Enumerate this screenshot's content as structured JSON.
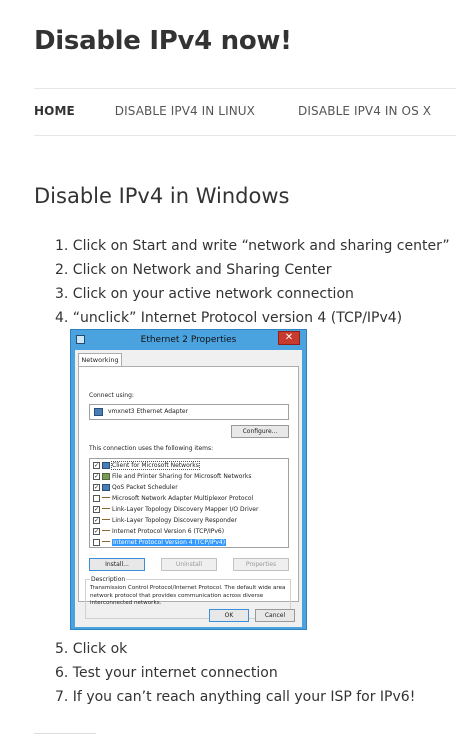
{
  "site": {
    "title": "Disable IPv4 now!"
  },
  "nav": {
    "items": [
      {
        "label": "HOME",
        "active": true
      },
      {
        "label": "DISABLE IPV4 IN LINUX",
        "active": false
      },
      {
        "label": "DISABLE IPV4 IN OS X",
        "active": false
      }
    ]
  },
  "article": {
    "title": "Disable IPv4 in Windows",
    "steps_before": [
      "1. Click on Start and write “network and sharing center”",
      "2. Click on Network and Sharing Center",
      "3. Click on your active network connection",
      "4. “unclick” Internet Protocol version 4 (TCP/IPv4)"
    ],
    "steps_after": [
      "5. Click ok",
      "6. Test your internet connection",
      "7. If you can’t reach anything call your ISP for IPv6!"
    ]
  },
  "dialog": {
    "title": "Ethernet 2 Properties",
    "close_glyph": "✕",
    "tab": "Networking",
    "connect_using_label": "Connect using:",
    "adapter": "vmxnet3 Ethernet Adapter",
    "configure_label": "Configure...",
    "items_label": "This connection uses the following items:",
    "items": [
      {
        "label": "Client for Microsoft Networks",
        "checked": true,
        "icon": "net"
      },
      {
        "label": "File and Printer Sharing for Microsoft Networks",
        "checked": true,
        "icon": "prt"
      },
      {
        "label": "QoS Packet Scheduler",
        "checked": true,
        "icon": "net"
      },
      {
        "label": "Microsoft Network Adapter Multiplexor Protocol",
        "checked": false,
        "icon": "proto"
      },
      {
        "label": "Link-Layer Topology Discovery Mapper I/O Driver",
        "checked": true,
        "icon": "proto"
      },
      {
        "label": "Link-Layer Topology Discovery Responder",
        "checked": true,
        "icon": "proto"
      },
      {
        "label": "Internet Protocol Version 6 (TCP/IPv6)",
        "checked": true,
        "icon": "proto"
      },
      {
        "label": "Internet Protocol Version 4 (TCP/IPv4)",
        "checked": false,
        "icon": "proto",
        "selected": true
      }
    ],
    "install_label": "Install...",
    "uninstall_label": "Uninstall",
    "properties_label": "Properties",
    "description_label": "Description",
    "description_text": "Transmission Control Protocol/Internet Protocol. The default wide area network protocol that provides communication across diverse interconnected networks.",
    "ok_label": "OK",
    "cancel_label": "Cancel"
  }
}
